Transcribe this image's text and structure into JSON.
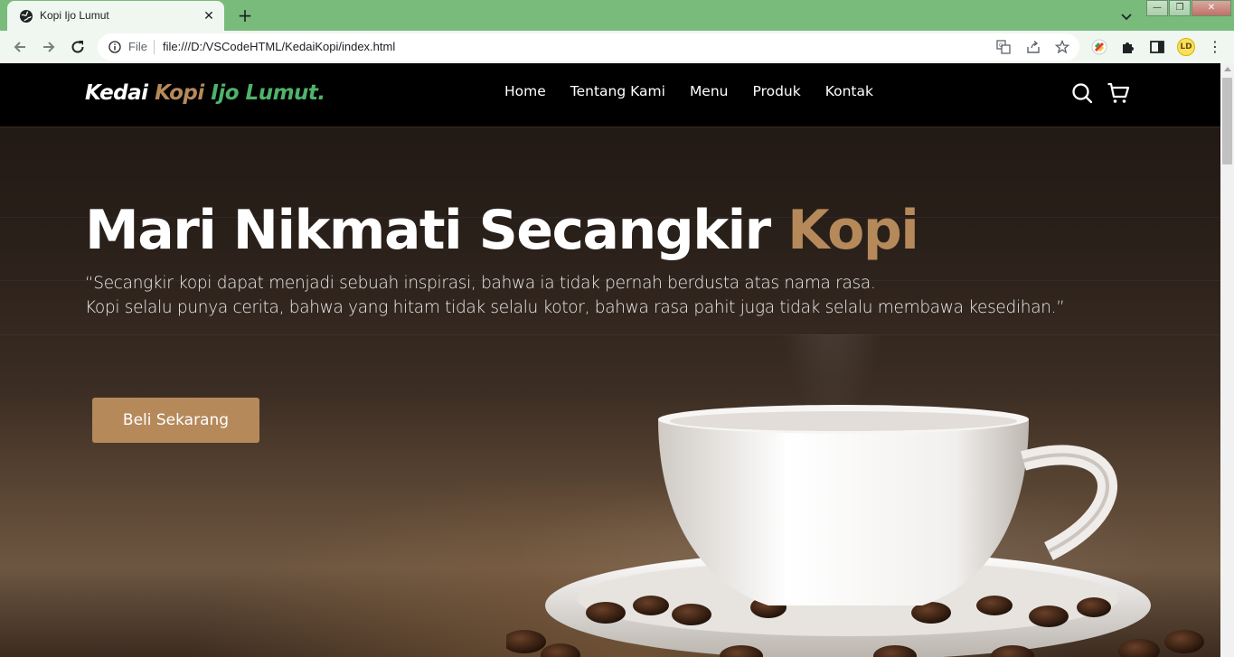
{
  "browser": {
    "tab_title": "Kopi Ijo Lumut",
    "scheme_label": "File",
    "url": "file:///D:/VSCodeHTML/KedaiKopi/index.html",
    "profile_initials": "LD"
  },
  "site": {
    "logo": {
      "part1": "Kedai",
      "part2": "Kopi",
      "part3": "Ijo Lumut."
    },
    "nav": [
      "Home",
      "Tentang Kami",
      "Menu",
      "Produk",
      "Kontak"
    ]
  },
  "hero": {
    "headline_main": "Mari Nikmati Secangkir",
    "headline_accent": "Kopi",
    "quote_line1": "“Secangkir kopi dapat menjadi sebuah inspirasi, bahwa ia tidak pernah berdusta atas nama rasa.",
    "quote_line2": "Kopi selalu punya cerita, bahwa yang hitam tidak selalu kotor, bahwa rasa pahit juga tidak selalu membawa kesedihan.”",
    "cta_label": "Beli Sekarang"
  },
  "colors": {
    "accent": "#b6895b",
    "brand_green": "#4fb36b",
    "browser_frame": "#78bb7b"
  }
}
